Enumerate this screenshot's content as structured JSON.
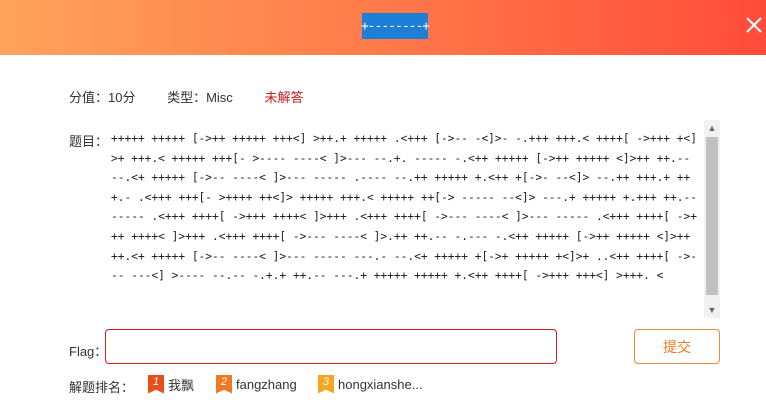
{
  "header": {
    "title": "+--------+"
  },
  "meta": {
    "score": "分值：10分",
    "type": "类型：Misc",
    "status": "未解答"
  },
  "question": {
    "label": "题目：",
    "text": "+++++ +++++ [->++ +++++ +++<] >++.+ +++++ .<+++ [->-- -<]>- -.+++ +++.< ++++[ ->+++ +<]>+ +++.< +++++ +++[- >---- ----< ]>--- --.+. ----- -.<++ +++++ [->++ +++++ <]>++ ++.-- --.<+ +++++ [->-- ----< ]>--- ----- .---- --.++ +++++ +.<++ +[->- --<]> --.++ +++.+ +++.- .<+++ +++[- >++++ ++<]> +++++ +++.< +++++ ++[-> ----- --<]> ---.+ +++++ +.+++ ++.-- ----- .<+++ ++++[ ->+++ ++++< ]>+++ .<+++ ++++[ ->--- ----< ]>--- ----- .<+++ ++++[ ->+++ ++++< ]>+++ .<+++ ++++[ ->--- ----< ]>.++ ++.-- -.--- -.<++ +++++ [->++ +++++ <]>++ ++.<+ +++++ [->-- ----< ]>--- ----- ---.- --.<+ +++++ +[->+ +++++ +<]>+ ..<++ ++++[ ->--- ---<] >---- --.-- -.+.+ ++.-- ---.+ +++++ +++++ +.<++ ++++[ ->+++ +++<] >+++. <"
  },
  "flag": {
    "label": "Flag：",
    "value": "",
    "placeholder": ""
  },
  "submit": {
    "label": "提交"
  },
  "ranking": {
    "label": "解题排名：",
    "items": [
      {
        "rank": "1",
        "name": "我飘",
        "color": "#e8501a"
      },
      {
        "rank": "2",
        "name": "fangzhang",
        "color": "#f07a22"
      },
      {
        "rank": "3",
        "name": "hongxianshe...",
        "color": "#f5a623"
      }
    ]
  },
  "icons": {
    "close": "close-icon",
    "scroll_up": "chevron-up-icon",
    "scroll_down": "chevron-down-icon"
  },
  "colors": {
    "header_start": "#ffa35c",
    "header_end": "#ff4c3a",
    "status": "#cc1a1a",
    "accent": "#f07a22",
    "input_border": "#d21e1e"
  }
}
